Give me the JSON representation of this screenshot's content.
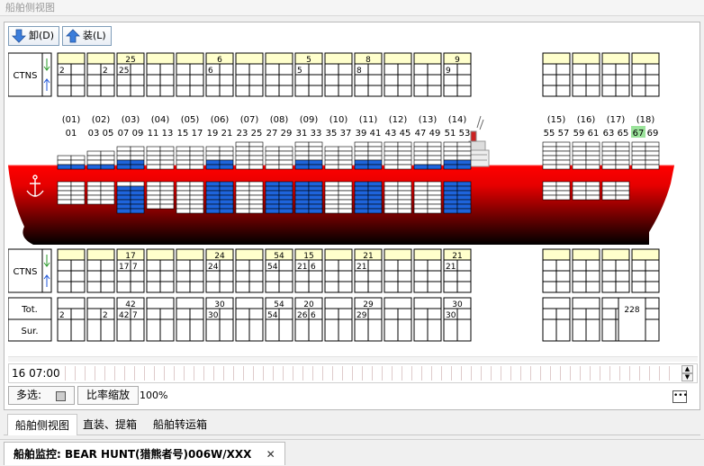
{
  "window_title": "船舶侧视图",
  "toolbar": {
    "unload_label": "卸(D)",
    "load_label": "装(L)"
  },
  "row_labels": {
    "ctns": "CTNS",
    "tot": "Tot.",
    "sur": "Sur."
  },
  "bays": [
    {
      "group": "(01)",
      "sub": "01",
      "top_total": "",
      "top_cells": [
        "2",
        ""
      ],
      "bot_total": "",
      "bot_cells": [
        "",
        ""
      ],
      "tot_total": "",
      "tot_cells": [
        "2",
        ""
      ]
    },
    {
      "group": "(02)",
      "sub": "03 05",
      "top_total": "",
      "top_cells": [
        "",
        "2"
      ],
      "bot_total": "",
      "bot_cells": [
        "",
        ""
      ],
      "tot_total": "",
      "tot_cells": [
        "",
        "2"
      ]
    },
    {
      "group": "(03)",
      "sub": "07 09",
      "top_total": "25",
      "top_cells": [
        "25",
        ""
      ],
      "bot_total": "17",
      "bot_cells": [
        "17",
        "7"
      ],
      "tot_total": "42",
      "tot_cells": [
        "42",
        "7"
      ]
    },
    {
      "group": "(04)",
      "sub": "11 13",
      "top_total": "",
      "top_cells": [
        "",
        ""
      ],
      "bot_total": "",
      "bot_cells": [
        "",
        ""
      ],
      "tot_total": "",
      "tot_cells": [
        "",
        ""
      ]
    },
    {
      "group": "(05)",
      "sub": "15 17",
      "top_total": "",
      "top_cells": [
        "",
        ""
      ],
      "bot_total": "",
      "bot_cells": [
        "",
        ""
      ],
      "tot_total": "",
      "tot_cells": [
        "",
        ""
      ]
    },
    {
      "group": "(06)",
      "sub": "19 21",
      "top_total": "6",
      "top_cells": [
        "6",
        ""
      ],
      "bot_total": "24",
      "bot_cells": [
        "24",
        ""
      ],
      "tot_total": "30",
      "tot_cells": [
        "30",
        ""
      ]
    },
    {
      "group": "(07)",
      "sub": "23 25",
      "top_total": "",
      "top_cells": [
        "",
        ""
      ],
      "bot_total": "",
      "bot_cells": [
        "",
        ""
      ],
      "tot_total": "",
      "tot_cells": [
        "",
        ""
      ]
    },
    {
      "group": "(08)",
      "sub": "27 29",
      "top_total": "",
      "top_cells": [
        "",
        ""
      ],
      "bot_total": "54",
      "bot_cells": [
        "54",
        ""
      ],
      "tot_total": "54",
      "tot_cells": [
        "54",
        ""
      ]
    },
    {
      "group": "(09)",
      "sub": "31 33",
      "top_total": "5",
      "top_cells": [
        "5",
        ""
      ],
      "bot_total": "15",
      "bot_cells": [
        "21",
        "6"
      ],
      "tot_total": "20",
      "tot_cells": [
        "26",
        "6"
      ]
    },
    {
      "group": "(10)",
      "sub": "35 37",
      "top_total": "",
      "top_cells": [
        "",
        ""
      ],
      "bot_total": "",
      "bot_cells": [
        "",
        ""
      ],
      "tot_total": "",
      "tot_cells": [
        "",
        ""
      ]
    },
    {
      "group": "(11)",
      "sub": "39 41",
      "top_total": "8",
      "top_cells": [
        "8",
        ""
      ],
      "bot_total": "21",
      "bot_cells": [
        "21",
        ""
      ],
      "tot_total": "29",
      "tot_cells": [
        "29",
        ""
      ]
    },
    {
      "group": "(12)",
      "sub": "43 45",
      "top_total": "",
      "top_cells": [
        "",
        ""
      ],
      "bot_total": "",
      "bot_cells": [
        "",
        ""
      ],
      "tot_total": "",
      "tot_cells": [
        "",
        ""
      ]
    },
    {
      "group": "(13)",
      "sub": "47 49",
      "top_total": "",
      "top_cells": [
        "",
        ""
      ],
      "bot_total": "",
      "bot_cells": [
        "",
        ""
      ],
      "tot_total": "",
      "tot_cells": [
        "",
        ""
      ]
    },
    {
      "group": "(14)",
      "sub": "51 53",
      "top_total": "9",
      "top_cells": [
        "9",
        ""
      ],
      "bot_total": "21",
      "bot_cells": [
        "21",
        ""
      ],
      "tot_total": "30",
      "tot_cells": [
        "30",
        ""
      ]
    },
    {
      "group": "(15)",
      "sub": "55 57",
      "top_total": "",
      "top_cells": [
        "",
        ""
      ],
      "bot_total": "",
      "bot_cells": [
        "",
        ""
      ],
      "tot_total": "",
      "tot_cells": [
        "",
        ""
      ]
    },
    {
      "group": "(16)",
      "sub": "59 61",
      "top_total": "",
      "top_cells": [
        "",
        ""
      ],
      "bot_total": "",
      "bot_cells": [
        "",
        ""
      ],
      "tot_total": "",
      "tot_cells": [
        "",
        ""
      ]
    },
    {
      "group": "(17)",
      "sub": "63 65",
      "top_total": "",
      "top_cells": [
        "",
        ""
      ],
      "bot_total": "",
      "bot_cells": [
        "",
        ""
      ],
      "tot_total": "",
      "tot_cells": [
        "",
        ""
      ]
    },
    {
      "group": "(18)",
      "sub": "67 69",
      "sub_highlight": "67",
      "top_total": "",
      "top_cells": [
        "",
        ""
      ],
      "bot_total": "",
      "bot_cells": [
        "",
        ""
      ],
      "tot_total": "",
      "tot_cells": [
        "",
        ""
      ]
    }
  ],
  "grand_total": "228",
  "timeline": {
    "time": "16 07:00"
  },
  "bottom": {
    "multi_select_label": "多选:",
    "scale_button": "比率缩放",
    "zoom": "100%"
  },
  "subtabs": [
    "船舶侧视图",
    "直装、提箱",
    "船舶转运箱"
  ],
  "doc_tab": {
    "title": "船舶监控: BEAR HUNT(猎熊者号)006W/XXX",
    "close": "✕"
  },
  "colors": {
    "header_yellow": "#ffffcc",
    "hull_red": "#ff0000",
    "container_blue": "#1e64dc",
    "highlight_green": "#9be39b"
  }
}
